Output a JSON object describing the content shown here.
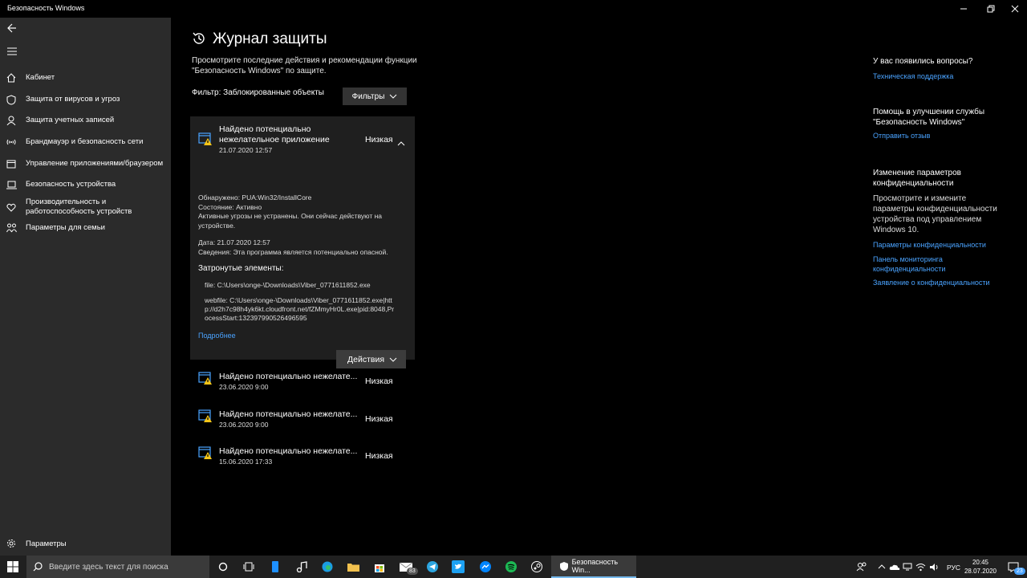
{
  "window": {
    "title": "Безопасность Windows"
  },
  "sidebar": {
    "items": [
      {
        "label": "Кабинет",
        "icon": "home-icon"
      },
      {
        "label": "Защита от вирусов и угроз",
        "icon": "shield-icon"
      },
      {
        "label": "Защита учетных записей",
        "icon": "person-icon"
      },
      {
        "label": "Брандмауэр и безопасность сети",
        "icon": "wifi-icon"
      },
      {
        "label": "Управление приложениями/браузером",
        "icon": "app-window-icon"
      },
      {
        "label": "Безопасность устройства",
        "icon": "laptop-icon"
      },
      {
        "label": "Производительность и работоспособность устройств",
        "icon": "heart-icon"
      },
      {
        "label": "Параметры для семьи",
        "icon": "family-icon"
      }
    ],
    "settings_label": "Параметры"
  },
  "main": {
    "title": "Журнал защиты",
    "subtitle": "Просмотрите последние действия и рекомендации функции \"Безопасность Windows\" по защите.",
    "filter_label": "Фильтр: Заблокированные объекты",
    "filter_button": "Фильтры",
    "expanded": {
      "title": "Найдено потенциально нежелательное приложение",
      "date": "21.07.2020 12:57",
      "severity": "Низкая",
      "detected": "Обнаружено: PUA:Win32/InstallCore",
      "status": "Состояние: Активно",
      "status_note": "Активные угрозы не устранены. Они сейчас действуют на устройстве.",
      "date_line": "Дата: 21.07.2020 12:57",
      "info": "Сведения: Эта программа является потенциально опасной.",
      "affected_header": "Затронутые элементы:",
      "file": "file: C:\\Users\\onge-\\Downloads\\Viber_0771611852.exe",
      "webfile": "webfile: C:\\Users\\onge-\\Downloads\\Viber_0771611852.exe|http://d2h7c98h4yk6kt.cloudfront.net/fZMmyHr0L.exe|pid:8048,ProcessStart:132397990526496595",
      "more_link": "Подробнее",
      "actions_button": "Действия"
    },
    "history": [
      {
        "title": "Найдено потенциально нежелате...",
        "date": "23.06.2020 9:00",
        "severity": "Низкая"
      },
      {
        "title": "Найдено потенциально нежелате...",
        "date": "23.06.2020 9:00",
        "severity": "Низкая"
      },
      {
        "title": "Найдено потенциально нежелате...",
        "date": "15.06.2020 17:33",
        "severity": "Низкая"
      }
    ]
  },
  "right_panel": {
    "questions_head": "У вас появились вопросы?",
    "support_link": "Техническая поддержка",
    "improve_head": "Помощь в улучшении службы \"Безопасность Windows\"",
    "feedback_link": "Отправить отзыв",
    "privacy_head": "Изменение параметров конфиденциальности",
    "privacy_text": "Просмотрите и измените параметры конфиденциальности устройства под управлением Windows 10.",
    "privacy_links": [
      "Параметры конфиденциальности",
      "Панель мониторинга конфиденциальности",
      "Заявление о конфиденциальности"
    ]
  },
  "taskbar": {
    "search_placeholder": "Введите здесь текст для поиска",
    "active_app": "Безопасность Win...",
    "mail_badge": "83",
    "lang": "РУС",
    "time": "20:45",
    "date": "28.07.2020",
    "notif_count": "23"
  },
  "colors": {
    "accent": "#4aa3ff",
    "warning": "#f5c518",
    "sidebar_bg": "#2b2b2b"
  }
}
